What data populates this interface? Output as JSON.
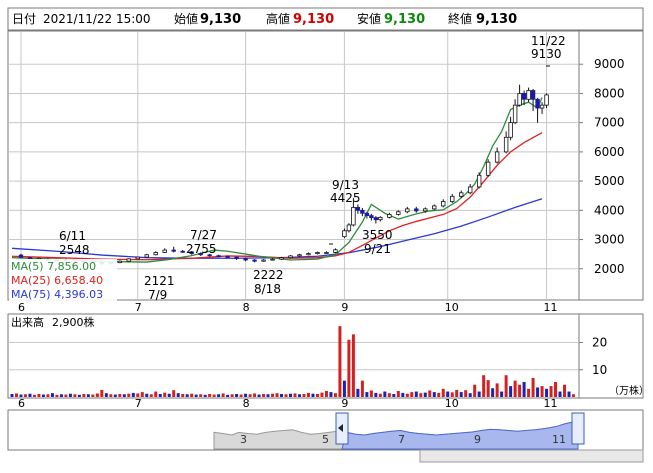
{
  "header": {
    "date_label": "日付",
    "date": "2021/11/22 15:00",
    "open_label": "始値",
    "open": "9,130",
    "high_label": "高値",
    "high": "9,130",
    "low_label": "安値",
    "low": "9,130",
    "close_label": "終値",
    "close": "9,130"
  },
  "colors": {
    "up": "#d40000",
    "down": "#0b8a0b",
    "candle": "#1a1aa8",
    "ma5": "#2e8b3a",
    "ma25": "#e02020",
    "ma75": "#2a38d8",
    "vol_up": "#d42020",
    "vol_down": "#1a22b0",
    "nav_fill": "#a8b8ee",
    "grid": "#c8c8c8"
  },
  "legend": [
    {
      "label": "MA(5)",
      "value": "7,856.00"
    },
    {
      "label": "MA(25)",
      "value": "6,658.40"
    },
    {
      "label": "MA(75)",
      "value": "4,396.03"
    }
  ],
  "volume_label": "出来高",
  "volume_value": "2,900株",
  "volume_unit": "（万株）",
  "chart_data": {
    "type": "candlestick",
    "price_axis": {
      "ticks": [
        2000,
        3000,
        4000,
        5000,
        6000,
        7000,
        8000,
        9000
      ],
      "min": 1000,
      "max": 10000
    },
    "volume_axis": {
      "ticks": [
        10,
        20
      ],
      "min": 0,
      "max": 29
    },
    "month_ticks": [
      "6",
      "7",
      "8",
      "9",
      "10",
      "11"
    ],
    "navigator_ticks": [
      "3",
      "5",
      "7",
      "9",
      "11"
    ],
    "annotations": [
      {
        "date": "6/11",
        "value": "2548"
      },
      {
        "date": "7/9",
        "value": "2121"
      },
      {
        "date": "7/27",
        "value": "2755"
      },
      {
        "date": "8/18",
        "value": "2222"
      },
      {
        "date": "9/13",
        "value": "4425"
      },
      {
        "date": "9/21",
        "value": "3550"
      },
      {
        "date": "11/22",
        "value": "9130"
      }
    ],
    "ma5": [
      [
        0,
        2380
      ],
      [
        10,
        2330
      ],
      [
        20,
        2250
      ],
      [
        30,
        2230
      ],
      [
        35,
        2320
      ],
      [
        40,
        2450
      ],
      [
        45,
        2640
      ],
      [
        48,
        2600
      ],
      [
        55,
        2430
      ],
      [
        62,
        2300
      ],
      [
        68,
        2330
      ],
      [
        72,
        2480
      ],
      [
        75,
        2900
      ],
      [
        78,
        3600
      ],
      [
        80,
        4200
      ],
      [
        83,
        3900
      ],
      [
        86,
        3700
      ],
      [
        90,
        3880
      ],
      [
        93,
        3980
      ],
      [
        96,
        4020
      ],
      [
        99,
        4300
      ],
      [
        101,
        4560
      ],
      [
        103,
        4900
      ],
      [
        105,
        5500
      ],
      [
        107,
        6200
      ],
      [
        109,
        6700
      ],
      [
        111,
        7450
      ],
      [
        113,
        7600
      ],
      [
        115,
        7700
      ],
      [
        117,
        7500
      ],
      [
        118,
        7856
      ]
    ],
    "ma25": [
      [
        0,
        2430
      ],
      [
        10,
        2380
      ],
      [
        20,
        2330
      ],
      [
        30,
        2310
      ],
      [
        40,
        2360
      ],
      [
        48,
        2440
      ],
      [
        55,
        2420
      ],
      [
        62,
        2360
      ],
      [
        68,
        2380
      ],
      [
        72,
        2440
      ],
      [
        75,
        2560
      ],
      [
        78,
        2800
      ],
      [
        81,
        3050
      ],
      [
        84,
        3300
      ],
      [
        87,
        3480
      ],
      [
        90,
        3620
      ],
      [
        93,
        3740
      ],
      [
        96,
        3860
      ],
      [
        99,
        4060
      ],
      [
        102,
        4450
      ],
      [
        105,
        4980
      ],
      [
        108,
        5540
      ],
      [
        111,
        6000
      ],
      [
        114,
        6320
      ],
      [
        118,
        6658
      ]
    ],
    "ma75": [
      [
        0,
        2700
      ],
      [
        10,
        2600
      ],
      [
        20,
        2470
      ],
      [
        30,
        2380
      ],
      [
        40,
        2360
      ],
      [
        50,
        2360
      ],
      [
        60,
        2380
      ],
      [
        68,
        2430
      ],
      [
        75,
        2550
      ],
      [
        82,
        2760
      ],
      [
        88,
        2980
      ],
      [
        94,
        3200
      ],
      [
        100,
        3460
      ],
      [
        106,
        3770
      ],
      [
        112,
        4100
      ],
      [
        118,
        4396
      ]
    ],
    "candles": [
      [
        2,
        2470,
        2390,
        2510,
        2380
      ],
      [
        4,
        2380,
        2360,
        2410,
        2330
      ],
      [
        6,
        2350,
        2360,
        2390,
        2320
      ],
      [
        8,
        2330,
        2300,
        2360,
        2280
      ],
      [
        10,
        2300,
        2280,
        2330,
        2260
      ],
      [
        12,
        2280,
        2320,
        2350,
        2250
      ],
      [
        14,
        2320,
        2290,
        2340,
        2260
      ],
      [
        16,
        2290,
        2260,
        2310,
        2230
      ],
      [
        18,
        2260,
        2230,
        2290,
        2200
      ],
      [
        20,
        2230,
        2180,
        2250,
        2121
      ],
      [
        22,
        2180,
        2210,
        2240,
        2150
      ],
      [
        24,
        2210,
        2260,
        2290,
        2190
      ],
      [
        26,
        2260,
        2340,
        2360,
        2240
      ],
      [
        28,
        2340,
        2400,
        2420,
        2320
      ],
      [
        30,
        2400,
        2480,
        2510,
        2380
      ],
      [
        32,
        2480,
        2560,
        2600,
        2460
      ],
      [
        34,
        2560,
        2640,
        2700,
        2540
      ],
      [
        36,
        2640,
        2600,
        2755,
        2560
      ],
      [
        38,
        2600,
        2580,
        2640,
        2540
      ],
      [
        40,
        2580,
        2520,
        2610,
        2480
      ],
      [
        42,
        2520,
        2480,
        2560,
        2440
      ],
      [
        44,
        2480,
        2450,
        2510,
        2420
      ],
      [
        46,
        2450,
        2420,
        2480,
        2390
      ],
      [
        48,
        2420,
        2400,
        2450,
        2370
      ],
      [
        50,
        2400,
        2350,
        2420,
        2300
      ],
      [
        52,
        2350,
        2300,
        2380,
        2260
      ],
      [
        54,
        2300,
        2260,
        2330,
        2222
      ],
      [
        56,
        2260,
        2300,
        2330,
        2240
      ],
      [
        58,
        2300,
        2330,
        2360,
        2280
      ],
      [
        60,
        2330,
        2380,
        2410,
        2300
      ],
      [
        62,
        2380,
        2440,
        2470,
        2350
      ],
      [
        64,
        2440,
        2480,
        2510,
        2410
      ],
      [
        66,
        2480,
        2520,
        2560,
        2460
      ],
      [
        68,
        2520,
        2560,
        2590,
        2490
      ],
      [
        70,
        2560,
        2560,
        2600,
        2520
      ],
      [
        72,
        2560,
        2650,
        2700,
        2530
      ],
      [
        74,
        3100,
        3300,
        3380,
        3050
      ],
      [
        75,
        3300,
        3500,
        3560,
        3240
      ],
      [
        76,
        3500,
        4100,
        4425,
        3450
      ],
      [
        77,
        4100,
        4000,
        4200,
        3880
      ],
      [
        78,
        4000,
        3900,
        4080,
        3800
      ],
      [
        79,
        3900,
        3820,
        3950,
        3720
      ],
      [
        80,
        3820,
        3750,
        3880,
        3650
      ],
      [
        81,
        3750,
        3680,
        3800,
        3550
      ],
      [
        82,
        3680,
        3760,
        3800,
        3620
      ],
      [
        84,
        3760,
        3860,
        3920,
        3720
      ],
      [
        86,
        3860,
        3950,
        4000,
        3820
      ],
      [
        88,
        3950,
        4050,
        4120,
        3900
      ],
      [
        90,
        4050,
        3980,
        4120,
        3920
      ],
      [
        92,
        3980,
        4050,
        4100,
        3920
      ],
      [
        94,
        4050,
        4150,
        4200,
        4000
      ],
      [
        96,
        4150,
        4300,
        4380,
        4100
      ],
      [
        98,
        4300,
        4480,
        4560,
        4250
      ],
      [
        100,
        4480,
        4600,
        4680,
        4420
      ],
      [
        102,
        4600,
        4800,
        4900,
        4550
      ],
      [
        104,
        4800,
        5200,
        5300,
        4750
      ],
      [
        106,
        5200,
        5650,
        5750,
        5150
      ],
      [
        108,
        5650,
        6000,
        6150,
        5600
      ],
      [
        110,
        6000,
        6500,
        6700,
        5950
      ],
      [
        111,
        6500,
        7000,
        7200,
        6400
      ],
      [
        112,
        7000,
        7600,
        7800,
        6950
      ],
      [
        113,
        7600,
        8000,
        8300,
        7550
      ],
      [
        114,
        8000,
        7800,
        8100,
        7600
      ],
      [
        115,
        7800,
        8100,
        8200,
        7700
      ],
      [
        116,
        8100,
        7800,
        8150,
        7400
      ],
      [
        117,
        7800,
        7500,
        7850,
        7000
      ],
      [
        118,
        7500,
        7600,
        7700,
        7300
      ],
      [
        119,
        7600,
        7950,
        8000,
        7500
      ]
    ],
    "volume": [
      [
        0,
        1.1,
        "d"
      ],
      [
        1,
        1.3,
        "u"
      ],
      [
        2,
        0.9,
        "d"
      ],
      [
        3,
        1.0,
        "u"
      ],
      [
        4,
        1.2,
        "d"
      ],
      [
        5,
        0.8,
        "u"
      ],
      [
        6,
        1.1,
        "u"
      ],
      [
        7,
        0.9,
        "d"
      ],
      [
        8,
        1.0,
        "u"
      ],
      [
        9,
        1.4,
        "d"
      ],
      [
        10,
        0.8,
        "u"
      ],
      [
        11,
        1.0,
        "d"
      ],
      [
        12,
        0.9,
        "u"
      ],
      [
        13,
        1.2,
        "d"
      ],
      [
        14,
        1.0,
        "u"
      ],
      [
        15,
        0.8,
        "d"
      ],
      [
        16,
        1.1,
        "u"
      ],
      [
        17,
        1.0,
        "d"
      ],
      [
        18,
        0.9,
        "u"
      ],
      [
        19,
        1.3,
        "u"
      ],
      [
        20,
        2.6,
        "u"
      ],
      [
        21,
        1.4,
        "d"
      ],
      [
        22,
        1.0,
        "u"
      ],
      [
        23,
        0.9,
        "d"
      ],
      [
        24,
        1.1,
        "u"
      ],
      [
        25,
        1.0,
        "d"
      ],
      [
        26,
        1.2,
        "u"
      ],
      [
        27,
        1.5,
        "d"
      ],
      [
        28,
        1.3,
        "u"
      ],
      [
        29,
        1.8,
        "u"
      ],
      [
        30,
        1.2,
        "d"
      ],
      [
        31,
        1.0,
        "u"
      ],
      [
        32,
        2.0,
        "u"
      ],
      [
        33,
        1.1,
        "d"
      ],
      [
        34,
        1.6,
        "u"
      ],
      [
        35,
        1.2,
        "d"
      ],
      [
        36,
        2.5,
        "u"
      ],
      [
        37,
        1.4,
        "d"
      ],
      [
        38,
        1.1,
        "u"
      ],
      [
        39,
        1.0,
        "d"
      ],
      [
        40,
        1.2,
        "u"
      ],
      [
        41,
        0.9,
        "d"
      ],
      [
        42,
        1.0,
        "u"
      ],
      [
        43,
        0.8,
        "d"
      ],
      [
        44,
        1.1,
        "u"
      ],
      [
        45,
        0.9,
        "u"
      ],
      [
        46,
        1.0,
        "d"
      ],
      [
        47,
        1.3,
        "u"
      ],
      [
        48,
        0.8,
        "d"
      ],
      [
        49,
        1.0,
        "u"
      ],
      [
        50,
        1.1,
        "d"
      ],
      [
        51,
        0.9,
        "u"
      ],
      [
        52,
        1.2,
        "d"
      ],
      [
        53,
        1.0,
        "u"
      ],
      [
        54,
        1.3,
        "u"
      ],
      [
        55,
        0.9,
        "d"
      ],
      [
        56,
        1.1,
        "u"
      ],
      [
        57,
        1.0,
        "d"
      ],
      [
        58,
        1.2,
        "u"
      ],
      [
        59,
        1.4,
        "u"
      ],
      [
        60,
        1.1,
        "d"
      ],
      [
        61,
        1.0,
        "u"
      ],
      [
        62,
        1.2,
        "d"
      ],
      [
        63,
        1.3,
        "u"
      ],
      [
        64,
        1.0,
        "d"
      ],
      [
        65,
        1.1,
        "u"
      ],
      [
        66,
        1.5,
        "u"
      ],
      [
        67,
        1.2,
        "d"
      ],
      [
        68,
        1.1,
        "u"
      ],
      [
        69,
        1.6,
        "u"
      ],
      [
        70,
        2.2,
        "u"
      ],
      [
        71,
        1.8,
        "d"
      ],
      [
        72,
        1.4,
        "u"
      ],
      [
        73,
        26.0,
        "u"
      ],
      [
        74,
        6.0,
        "d"
      ],
      [
        75,
        21.0,
        "u"
      ],
      [
        76,
        23.0,
        "u"
      ],
      [
        77,
        3.0,
        "d"
      ],
      [
        78,
        6.0,
        "u"
      ],
      [
        79,
        1.8,
        "d"
      ],
      [
        80,
        2.4,
        "u"
      ],
      [
        81,
        1.5,
        "d"
      ],
      [
        82,
        1.2,
        "u"
      ],
      [
        83,
        2.0,
        "d"
      ],
      [
        84,
        1.4,
        "u"
      ],
      [
        85,
        1.1,
        "d"
      ],
      [
        86,
        2.2,
        "u"
      ],
      [
        87,
        1.5,
        "d"
      ],
      [
        88,
        1.2,
        "u"
      ],
      [
        89,
        1.8,
        "u"
      ],
      [
        90,
        2.0,
        "d"
      ],
      [
        91,
        1.4,
        "u"
      ],
      [
        92,
        1.6,
        "d"
      ],
      [
        93,
        2.4,
        "u"
      ],
      [
        94,
        1.8,
        "d"
      ],
      [
        95,
        1.5,
        "u"
      ],
      [
        96,
        3.0,
        "u"
      ],
      [
        97,
        2.0,
        "d"
      ],
      [
        98,
        1.7,
        "u"
      ],
      [
        99,
        2.6,
        "u"
      ],
      [
        100,
        1.8,
        "d"
      ],
      [
        101,
        2.5,
        "u"
      ],
      [
        102,
        1.4,
        "d"
      ],
      [
        103,
        4.5,
        "u"
      ],
      [
        104,
        2.0,
        "d"
      ],
      [
        105,
        8.0,
        "u"
      ],
      [
        106,
        6.2,
        "u"
      ],
      [
        107,
        3.2,
        "d"
      ],
      [
        108,
        5.0,
        "u"
      ],
      [
        109,
        2.0,
        "d"
      ],
      [
        110,
        8.0,
        "u"
      ],
      [
        111,
        4.0,
        "d"
      ],
      [
        112,
        6.0,
        "u"
      ],
      [
        113,
        4.5,
        "u"
      ],
      [
        114,
        5.5,
        "d"
      ],
      [
        115,
        3.0,
        "u"
      ],
      [
        116,
        7.0,
        "u"
      ],
      [
        117,
        3.5,
        "d"
      ],
      [
        118,
        4.0,
        "u"
      ],
      [
        119,
        3.0,
        "d"
      ],
      [
        120,
        4.0,
        "u"
      ],
      [
        121,
        5.5,
        "u"
      ],
      [
        122,
        2.0,
        "d"
      ],
      [
        123,
        4.5,
        "u"
      ],
      [
        124,
        2.0,
        "d"
      ],
      [
        125,
        1.0,
        "u"
      ]
    ],
    "navigator": [
      [
        0,
        0.55
      ],
      [
        8,
        0.58
      ],
      [
        16,
        0.62
      ],
      [
        22,
        0.55
      ],
      [
        30,
        0.58
      ],
      [
        38,
        0.6
      ],
      [
        46,
        0.55
      ],
      [
        54,
        0.52
      ],
      [
        62,
        0.5
      ],
      [
        70,
        0.48
      ],
      [
        78,
        0.55
      ],
      [
        86,
        0.6
      ],
      [
        94,
        0.58
      ],
      [
        102,
        0.55
      ],
      [
        110,
        0.52
      ],
      [
        118,
        0.55
      ],
      [
        126,
        0.6
      ],
      [
        134,
        0.62
      ],
      [
        142,
        0.58
      ],
      [
        150,
        0.55
      ],
      [
        158,
        0.52
      ],
      [
        166,
        0.5
      ],
      [
        174,
        0.55
      ],
      [
        182,
        0.58
      ],
      [
        190,
        0.6
      ],
      [
        198,
        0.62
      ],
      [
        206,
        0.6
      ],
      [
        214,
        0.58
      ],
      [
        222,
        0.56
      ],
      [
        230,
        0.54
      ],
      [
        238,
        0.5
      ],
      [
        246,
        0.47
      ],
      [
        254,
        0.48
      ],
      [
        262,
        0.5
      ],
      [
        270,
        0.52
      ],
      [
        278,
        0.5
      ],
      [
        286,
        0.48
      ],
      [
        294,
        0.45
      ],
      [
        300,
        0.42
      ],
      [
        306,
        0.38
      ],
      [
        312,
        0.32
      ],
      [
        318,
        0.28
      ],
      [
        324,
        0.26
      ]
    ]
  }
}
